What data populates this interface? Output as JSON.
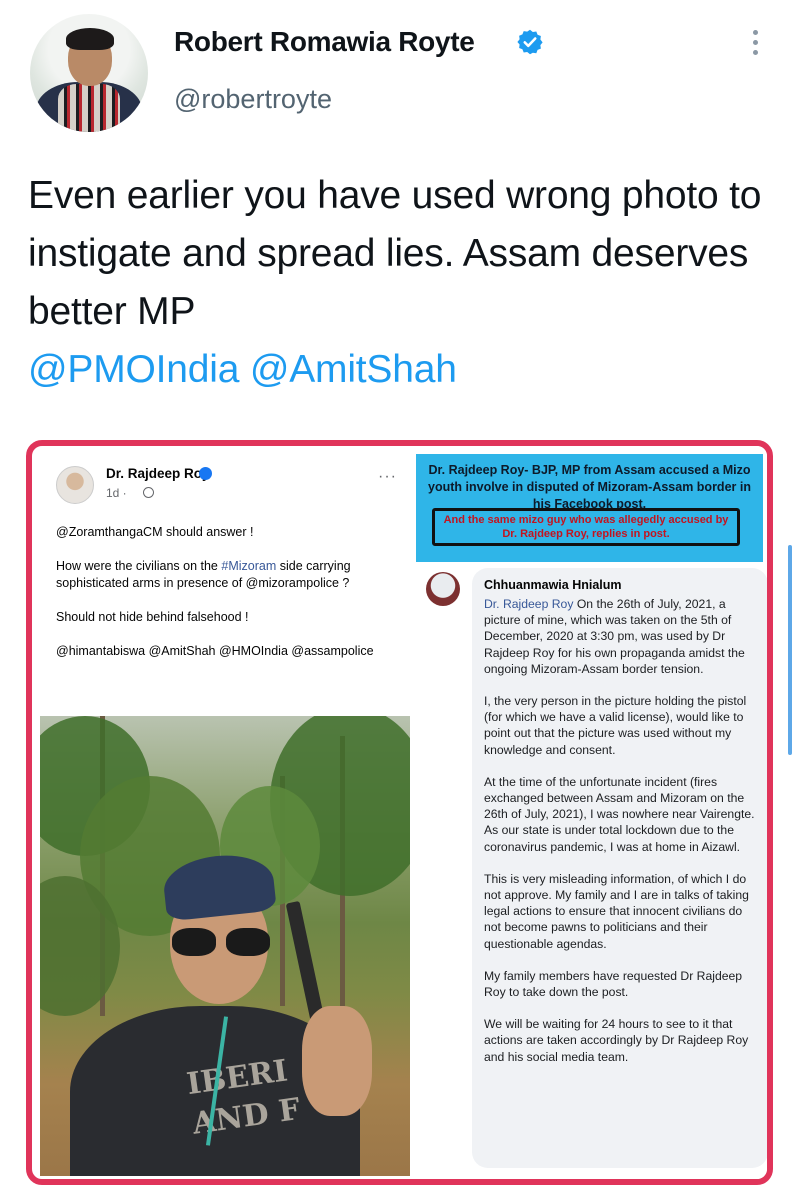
{
  "tweet": {
    "author": {
      "display_name": "Robert Romawia Royte",
      "handle": "@robertroyte",
      "verified_icon": "verified-badge-icon",
      "avatar": "avatar-icon"
    },
    "text": "Even earlier you have used wrong photo to instigate and spread lies. Assam deserves better MP",
    "mentions": [
      "@PMOIndia",
      "@AmitShah"
    ]
  },
  "media": {
    "facebook_post": {
      "author": "Dr. Rajdeep Roy",
      "time": "1d ·",
      "more": "···",
      "paragraphs": [
        "@ZoramthangaCM should answer !",
        "How were the civilians on the",
        "#Mizoram",
        "side carrying sophisticated arms in presence of @mizorampolice ?",
        "Should not hide behind falsehood !",
        "@himantabiswa @AmitShah @HMOIndia @assampolice"
      ],
      "shirt_print": "IBERI\nAND F"
    },
    "banner": {
      "title": "Dr. Rajdeep Roy- BJP, MP from Assam accused a Mizo youth involve in disputed of Mizoram-Assam border in his Facebook post.",
      "note": "And the same mizo guy who was allegedly accused by Dr. Rajdeep Roy, replies in post."
    },
    "comment": {
      "author": "Chhuanmawia Hnialum",
      "tag": "Dr. Rajdeep Roy",
      "p1": "On the 26th of July, 2021, a picture of mine, which was taken on the 5th of December, 2020 at 3:30 pm, was used by Dr Rajdeep Roy for his own propaganda amidst the ongoing Mizoram-Assam border tension.",
      "p2": "I, the very person in the picture holding the pistol (for which we have a valid license), would like to point out that the picture was used without my knowledge and consent.",
      "p3": "At the time of the unfortunate incident (fires exchanged between Assam and Mizoram on the 26th of July, 2021), I was nowhere near Vairengte. As our state is under total lockdown due to the coronavirus pandemic, I was at home in Aizawl.",
      "p4": "This is very misleading information, of which I do not approve. My family and I are in talks of taking legal actions to ensure that innocent civilians do not become pawns to politicians and their questionable agendas.",
      "p5": "My family members have requested Dr Rajdeep Roy to take down the post.",
      "p6": "We will be waiting for 24 hours to see to it that actions are taken accordingly by Dr Rajdeep Roy and his social media team."
    }
  },
  "colors": {
    "accent": "#1d9bf0",
    "frame": "#e0345a",
    "banner": "#2fb5e8",
    "note": "#c3141f"
  }
}
